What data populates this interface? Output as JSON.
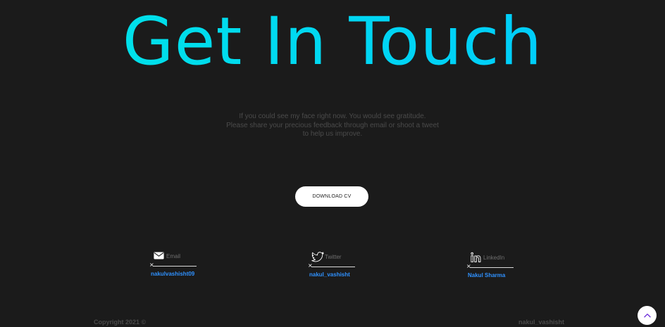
{
  "hero": {
    "title": "Get In Touch"
  },
  "message": {
    "line1": "If you could see my face right now. You would see gratitude.",
    "line2": "Please share your precious feedback through email or shoot a tweet",
    "line3": "to help us improve."
  },
  "cv_button": {
    "label": "DOWNLOAD CV"
  },
  "contacts": [
    {
      "icon": "mail-icon",
      "label": "Email",
      "handle": "nakulvashisht09"
    },
    {
      "icon": "twitter-icon",
      "label": "Twitter",
      "handle": "nakul_vashisht"
    },
    {
      "icon": "linkedin-icon",
      "label": "LinkedIn",
      "handle": "Nakul Sharma"
    }
  ],
  "footer": {
    "copyright": "Copyright 2021 ©",
    "author": "nakul_vashisht"
  },
  "colors": {
    "background": "#1b1b1b",
    "title_gradient_start": "#00e5e5",
    "title_gradient_end": "#00c8ff",
    "muted_text": "#4b4b4b",
    "link": "#2f91ff"
  }
}
